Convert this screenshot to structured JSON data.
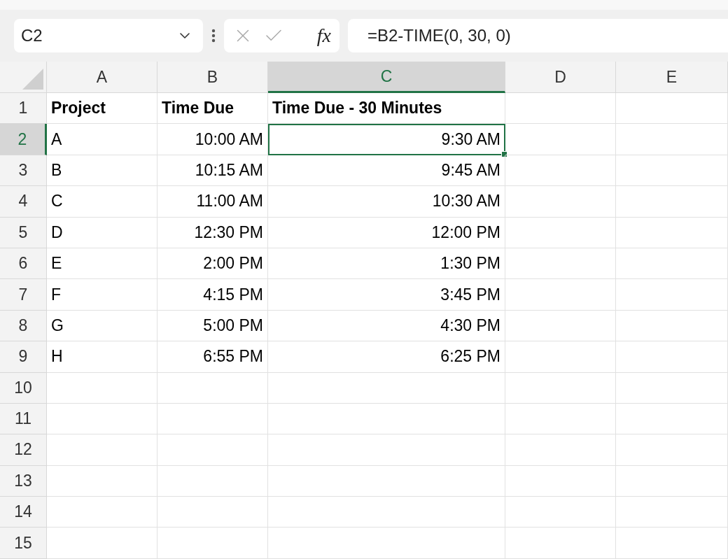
{
  "formula_bar": {
    "name_box": "C2",
    "function_label": "fx",
    "formula": "=B2-TIME(0, 30, 0)"
  },
  "columns": [
    {
      "label": "A",
      "selected": false
    },
    {
      "label": "B",
      "selected": false
    },
    {
      "label": "C",
      "selected": true
    },
    {
      "label": "D",
      "selected": false
    },
    {
      "label": "E",
      "selected": false
    }
  ],
  "rows": [
    {
      "number": "1",
      "selected": false,
      "kind": "header",
      "cells": [
        "Project",
        "Time Due",
        "Time Due - 30 Minutes"
      ]
    },
    {
      "number": "2",
      "selected": true,
      "kind": "data",
      "cells": [
        "A",
        "10:00 AM",
        "9:30 AM"
      ]
    },
    {
      "number": "3",
      "selected": false,
      "kind": "data",
      "cells": [
        "B",
        "10:15 AM",
        "9:45 AM"
      ]
    },
    {
      "number": "4",
      "selected": false,
      "kind": "data",
      "cells": [
        "C",
        "11:00 AM",
        "10:30 AM"
      ]
    },
    {
      "number": "5",
      "selected": false,
      "kind": "data",
      "cells": [
        "D",
        "12:30 PM",
        "12:00 PM"
      ]
    },
    {
      "number": "6",
      "selected": false,
      "kind": "data",
      "cells": [
        "E",
        "2:00 PM",
        "1:30 PM"
      ]
    },
    {
      "number": "7",
      "selected": false,
      "kind": "data",
      "cells": [
        "F",
        "4:15 PM",
        "3:45 PM"
      ]
    },
    {
      "number": "8",
      "selected": false,
      "kind": "data",
      "cells": [
        "G",
        "5:00 PM",
        "4:30 PM"
      ]
    },
    {
      "number": "9",
      "selected": false,
      "kind": "data",
      "cells": [
        "H",
        "6:55 PM",
        "6:25 PM"
      ]
    },
    {
      "number": "10",
      "selected": false,
      "kind": "empty"
    },
    {
      "number": "11",
      "selected": false,
      "kind": "empty"
    },
    {
      "number": "12",
      "selected": false,
      "kind": "empty"
    },
    {
      "number": "13",
      "selected": false,
      "kind": "empty"
    },
    {
      "number": "14",
      "selected": false,
      "kind": "empty"
    },
    {
      "number": "15",
      "selected": false,
      "kind": "empty"
    }
  ]
}
